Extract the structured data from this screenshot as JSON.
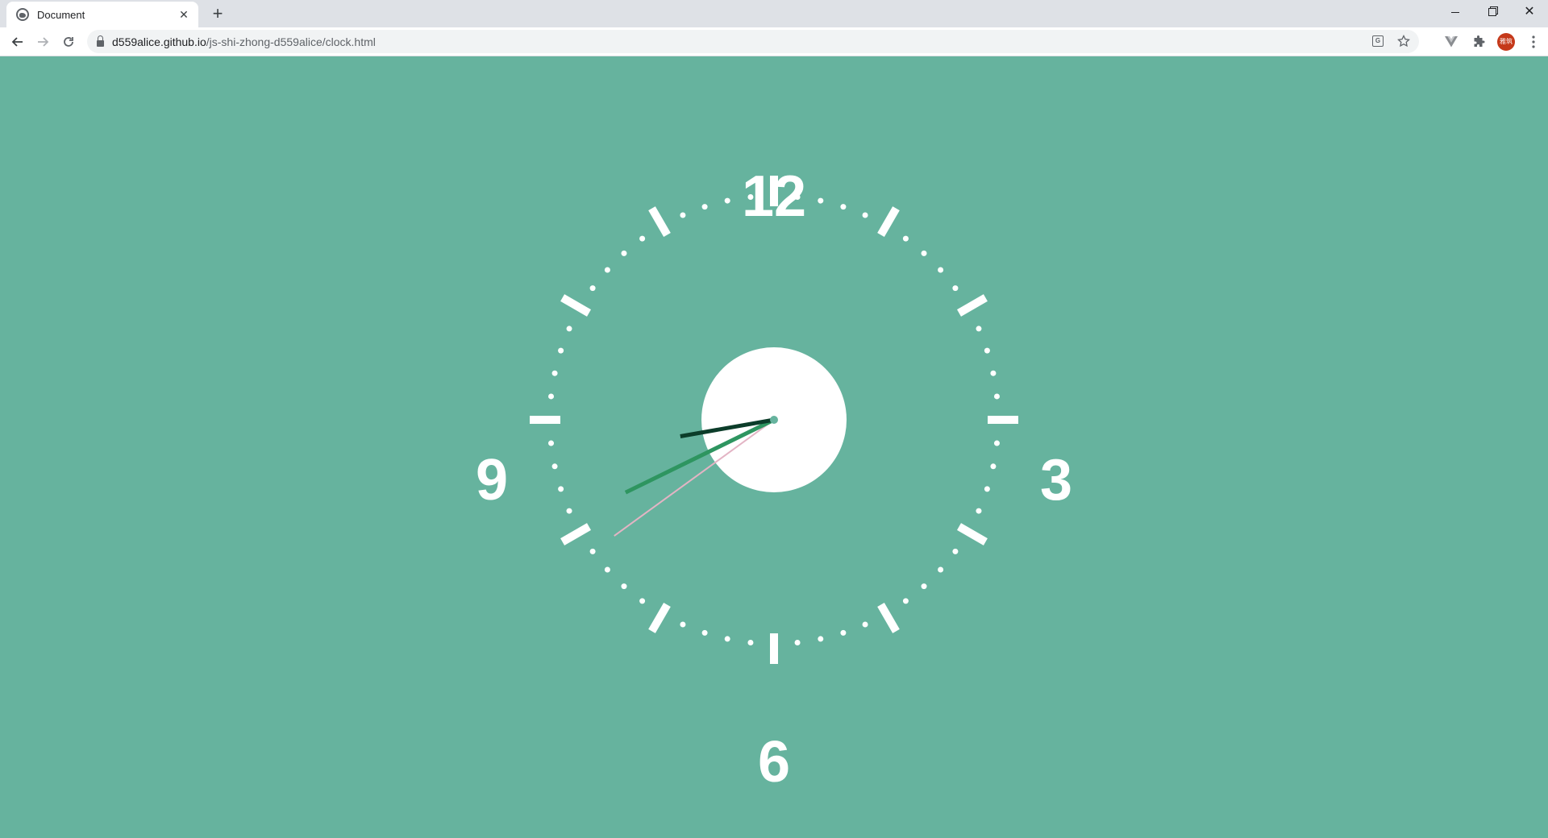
{
  "browser": {
    "tab_title": "Document",
    "tab_close_glyph": "✕",
    "new_tab_glyph": "+",
    "url_host": "d559alice.github.io",
    "url_path": "/js-shi-zhong-d559alice/clock.html",
    "avatar_text": "雅筑",
    "icons": [
      "back-arrow-icon",
      "forward-arrow-icon",
      "reload-icon",
      "lock-icon",
      "translate-icon",
      "star-icon",
      "vuejs-devtools-icon",
      "puzzle-extensions-icon",
      "menu-dots-icon"
    ]
  },
  "clock": {
    "numerals": {
      "twelve": "12",
      "three": "3",
      "six": "6",
      "nine": "9"
    },
    "time": {
      "hours": 8,
      "minutes": 40,
      "seconds": 39
    },
    "colors": {
      "background": "#66b39e",
      "face_center": "#ffffff",
      "ticks": "#ffffff",
      "hour_hand": "#0c3d2a",
      "minute_hand": "#2e9560",
      "second_hand": "#e3b4c4",
      "pivot": "#66b39e"
    }
  }
}
